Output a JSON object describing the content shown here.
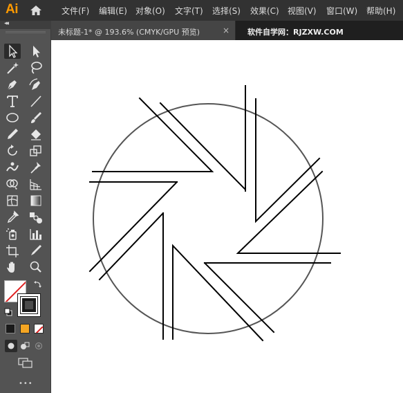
{
  "app": {
    "logo": "Ai",
    "home_icon": "home-icon"
  },
  "menu": [
    {
      "label": "文件(F)"
    },
    {
      "label": "编辑(E)"
    },
    {
      "label": "对象(O)"
    },
    {
      "label": "文字(T)"
    },
    {
      "label": "选择(S)"
    },
    {
      "label": "效果(C)"
    },
    {
      "label": "视图(V)"
    },
    {
      "label": "窗口(W)"
    },
    {
      "label": "帮助(H)"
    }
  ],
  "tabs": {
    "document": "未标题-1* @ 193.6% (CMYK/GPU 预览)",
    "close_glyph": "×",
    "site": "软件自学网：RJZXW.COM"
  },
  "tools_panel": {
    "collapse_glyph": "◂◂",
    "more_glyph": "•••",
    "tools": [
      {
        "name": "selection-tool",
        "icon": "arrow-outline-icon",
        "selected": true
      },
      {
        "name": "direct-selection-tool",
        "icon": "arrow-solid-icon"
      },
      {
        "name": "magic-wand-tool",
        "icon": "magic-wand-icon"
      },
      {
        "name": "lasso-tool",
        "icon": "lasso-icon"
      },
      {
        "name": "pen-tool",
        "icon": "pen-icon"
      },
      {
        "name": "curvature-tool",
        "icon": "curvature-icon"
      },
      {
        "name": "type-tool",
        "icon": "type-icon",
        "glyph": "T"
      },
      {
        "name": "line-segment-tool",
        "icon": "line-icon"
      },
      {
        "name": "ellipse-tool",
        "icon": "ellipse-icon"
      },
      {
        "name": "paintbrush-tool",
        "icon": "brush-icon"
      },
      {
        "name": "pencil-tool",
        "icon": "pencil-icon"
      },
      {
        "name": "eraser-tool",
        "icon": "eraser-icon"
      },
      {
        "name": "rotate-tool",
        "icon": "rotate-icon"
      },
      {
        "name": "scale-tool",
        "icon": "scale-icon"
      },
      {
        "name": "puppet-warp-tool",
        "icon": "puppet-warp-icon"
      },
      {
        "name": "pin-tool",
        "icon": "pin-icon"
      },
      {
        "name": "shape-builder-tool",
        "icon": "shape-builder-icon"
      },
      {
        "name": "perspective-grid-tool",
        "icon": "perspective-grid-icon"
      },
      {
        "name": "mesh-tool",
        "icon": "mesh-icon"
      },
      {
        "name": "gradient-tool",
        "icon": "gradient-icon"
      },
      {
        "name": "eyedropper-tool",
        "icon": "eyedropper-icon"
      },
      {
        "name": "blend-tool",
        "icon": "blend-icon"
      },
      {
        "name": "symbol-sprayer-tool",
        "icon": "symbol-sprayer-icon"
      },
      {
        "name": "column-graph-tool",
        "icon": "column-graph-icon"
      },
      {
        "name": "artboard-tool",
        "icon": "artboard-icon"
      },
      {
        "name": "slice-tool",
        "icon": "slice-icon"
      },
      {
        "name": "hand-tool",
        "icon": "hand-icon"
      },
      {
        "name": "zoom-tool",
        "icon": "zoom-icon"
      }
    ],
    "fill": {
      "color": "#ffffff",
      "state": "none"
    },
    "stroke": {
      "color": "#1a1a1a"
    },
    "color_modes": [
      {
        "name": "color-mode-button",
        "color": "#1a1a1a"
      },
      {
        "name": "gradient-mode-button",
        "color": "#f5a623"
      },
      {
        "name": "none-mode-button",
        "color": "#ffffff"
      }
    ],
    "draw_modes": [
      "draw-normal-icon",
      "draw-behind-icon",
      "draw-inside-icon"
    ],
    "screen_mode_icon": "screen-mode-icon"
  },
  "artwork": {
    "circle_stroke": "#555555",
    "line_stroke": "#000000"
  }
}
